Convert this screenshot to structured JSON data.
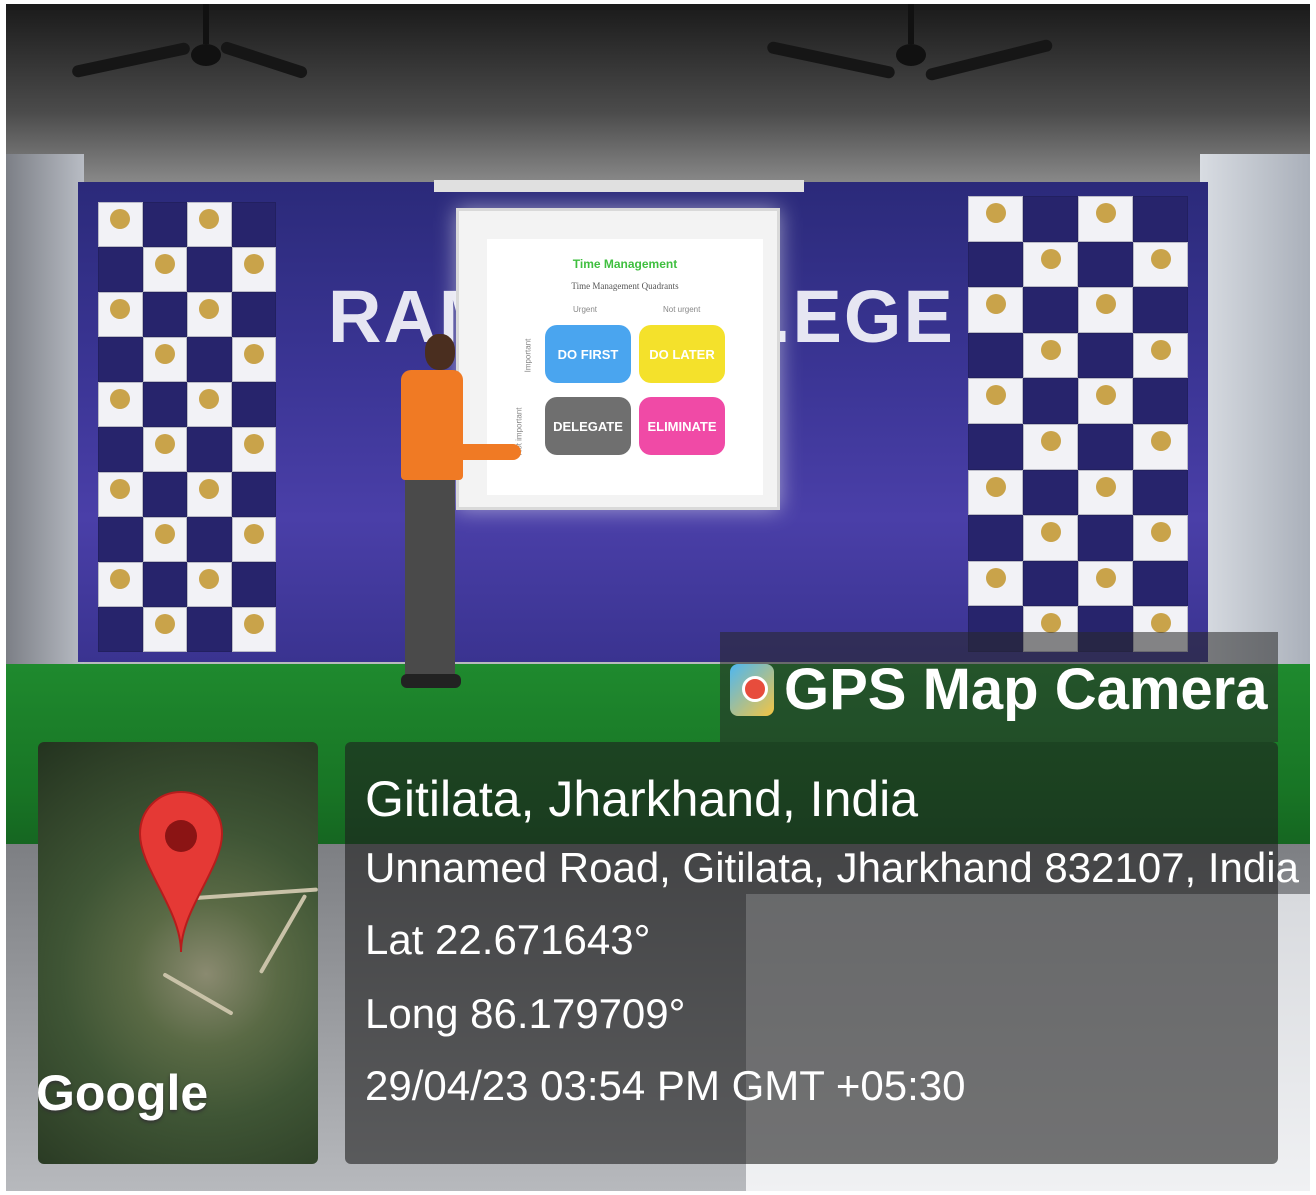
{
  "overlay": {
    "app_name": "GPS Map Camera",
    "location": "Gitilata, Jharkhand, India",
    "address": "Unnamed Road, Gitilata, Jharkhand 832107, India",
    "latitude": "Lat 22.671643°",
    "longitude": "Long 86.179709°",
    "datetime": "29/04/23 03:54 PM GMT +05:30"
  },
  "map": {
    "attribution": "Google"
  },
  "banner": {
    "left_text": "RAM",
    "right_text": ".EGE"
  },
  "slide": {
    "title": "Time Management",
    "subtitle": "Time Management Quadrants",
    "col_urgent": "Urgent",
    "col_not_urgent": "Not urgent",
    "row_important": "Important",
    "row_not_important": "Not important",
    "quadrants": [
      "DO FIRST",
      "DO LATER",
      "DELEGATE",
      "ELIMINATE"
    ]
  },
  "colors": {
    "do_first": "#4aa5ef",
    "do_later": "#f4e12b",
    "delegate": "#6f6f6f",
    "eliminate": "#f04aa6",
    "pin": "#e53935"
  }
}
